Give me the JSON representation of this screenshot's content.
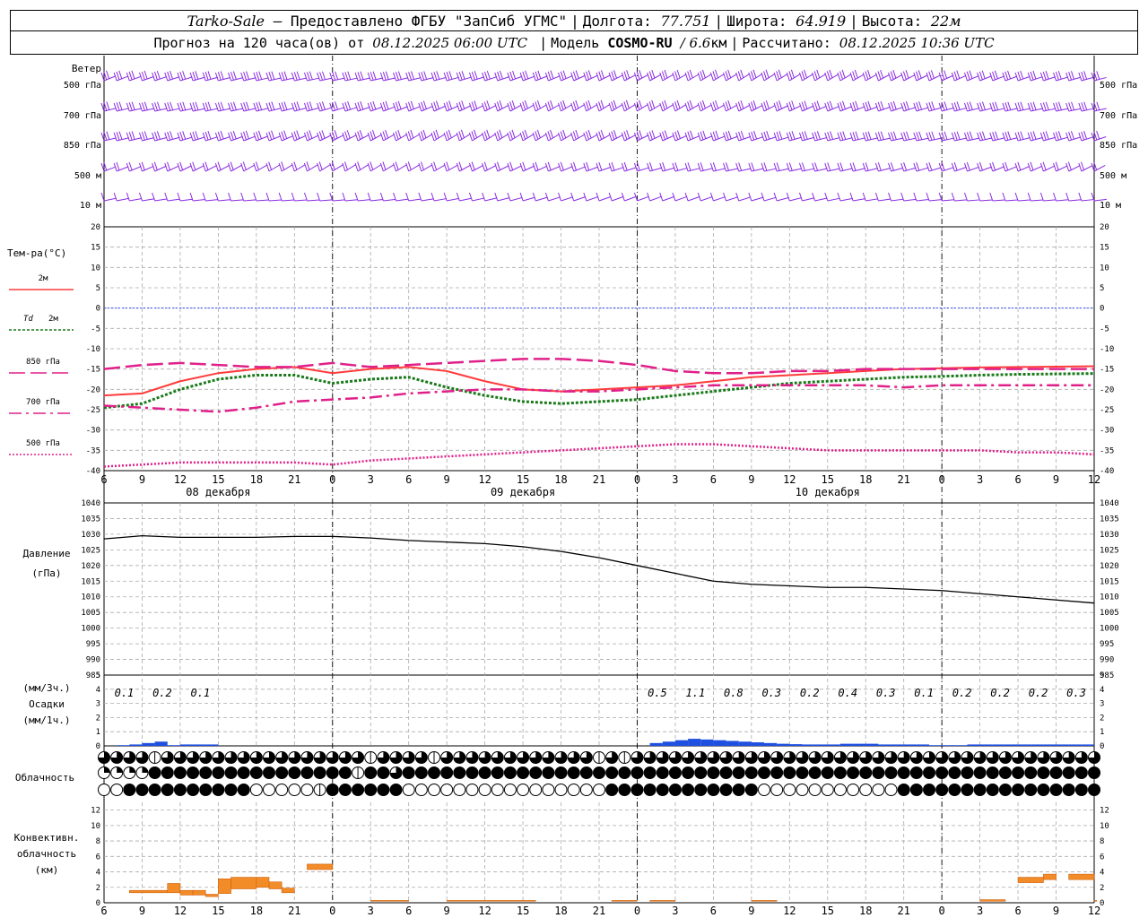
{
  "header": {
    "station": "Tarko-Sale",
    "provider": "– Предоставлено ФГБУ \"ЗапСиб УГМС\"",
    "lon_label": "Долгота:",
    "lon_value": "77.751",
    "lat_label": "Широта:",
    "lat_value": "64.919",
    "alt_label": "Высота:",
    "alt_value": "22м",
    "forecast_label": "Прогноз на 120 часа(ов) от",
    "forecast_start": "08.12.2025 06:00 UTC",
    "model_label": "Модель",
    "model_name": "COSMO-RU",
    "model_res": "/ 6.6",
    "model_res_unit": "км",
    "calc_label": "Рассчитано:",
    "calc_time": "08.12.2025 10:36 UTC"
  },
  "chart_data": [
    {
      "id": "wind",
      "type": "wind_barbs",
      "title": "Ветер",
      "levels": [
        "500 гПа",
        "700 гПа",
        "850 гПа",
        "500 м",
        "10 м"
      ],
      "barb_color": "#8a2be2"
    },
    {
      "id": "temperature",
      "type": "line",
      "ylabel": "Тем-ра(°C)",
      "ylim": [
        -40,
        20
      ],
      "yticks": [
        20,
        15,
        10,
        5,
        0,
        -5,
        -10,
        -15,
        -20,
        -25,
        -30,
        -35,
        -40
      ],
      "x_hours": [
        6,
        9,
        12,
        15,
        18,
        21,
        24,
        27,
        30,
        33,
        36,
        39,
        42,
        45,
        48,
        51,
        54,
        57,
        60,
        63,
        66,
        69,
        72,
        75,
        78,
        81,
        84
      ],
      "series": [
        {
          "name": "2м",
          "color": "#ff3b3b",
          "dash": "solid",
          "values": [
            -21.5,
            -21,
            -18,
            -16,
            -15,
            -14.5,
            -16,
            -15,
            -14.5,
            -15.5,
            -18,
            -20,
            -20.5,
            -20,
            -19.5,
            -19,
            -18,
            -17,
            -16.5,
            -16,
            -15.5,
            -15,
            -14.8,
            -14.6,
            -14.5,
            -14.4,
            -14.3
          ]
        },
        {
          "name": "Td 2м",
          "color": "#1a7a1a",
          "dash": "dot",
          "values": [
            -24.5,
            -23.5,
            -20,
            -17.5,
            -16.5,
            -16.5,
            -18.5,
            -17.5,
            -17,
            -19.5,
            -21.5,
            -23,
            -23.5,
            -23,
            -22.5,
            -21.5,
            -20.5,
            -19.5,
            -18.5,
            -18,
            -17.5,
            -17,
            -16.8,
            -16.5,
            -16.3,
            -16.2,
            -16.1
          ]
        },
        {
          "name": "850 гПа",
          "color": "#e0208a",
          "dash": "longdash",
          "values": [
            -15,
            -14,
            -13.5,
            -14,
            -14.5,
            -14.5,
            -13.5,
            -14.5,
            -14,
            -13.5,
            -13,
            -12.5,
            -12.5,
            -13,
            -14,
            -15.5,
            -16,
            -16,
            -15.5,
            -15.5,
            -15,
            -15,
            -15,
            -15,
            -15,
            -15,
            -15
          ]
        },
        {
          "name": "700 гПа",
          "color": "#e0208a",
          "dash": "dashdot",
          "values": [
            -24,
            -24.5,
            -25,
            -25.5,
            -24.5,
            -23,
            -22.5,
            -22,
            -21,
            -20.5,
            -20,
            -20,
            -20.5,
            -20.5,
            -20,
            -19.5,
            -19,
            -19,
            -19,
            -19,
            -19,
            -19.5,
            -19,
            -19,
            -19,
            -19,
            -19
          ]
        },
        {
          "name": "500 гПа",
          "color": "#e0208a",
          "dash": "smalldot",
          "values": [
            -39,
            -38.5,
            -38,
            -38,
            -38,
            -38,
            -38.5,
            -37.5,
            -37,
            -36.5,
            -36,
            -35.5,
            -35,
            -34.5,
            -34,
            -33.5,
            -33.5,
            -34,
            -34.5,
            -35,
            -35,
            -35,
            -35,
            -35,
            -35.5,
            -35.5,
            -36
          ]
        }
      ]
    },
    {
      "id": "pressure",
      "type": "line",
      "ylabel": "Давление",
      "yunit": "(гПа)",
      "ylim": [
        985,
        1040
      ],
      "yticks": [
        1040,
        1035,
        1030,
        1025,
        1020,
        1015,
        1010,
        1005,
        1000,
        995,
        990,
        985
      ],
      "x_hours": [
        6,
        9,
        12,
        15,
        18,
        21,
        24,
        27,
        30,
        33,
        36,
        39,
        42,
        45,
        48,
        51,
        54,
        57,
        60,
        63,
        66,
        69,
        72,
        75,
        78,
        81,
        84
      ],
      "series": [
        {
          "name": "Давление",
          "color": "#000000",
          "values": [
            1028.5,
            1029.5,
            1029,
            1029,
            1029,
            1029.3,
            1029.3,
            1028.8,
            1028,
            1027.5,
            1027,
            1026,
            1024.5,
            1022.5,
            1020,
            1017.5,
            1015,
            1014,
            1013.5,
            1013,
            1013,
            1012.5,
            1012,
            1011,
            1010,
            1009,
            1008
          ]
        }
      ]
    },
    {
      "id": "precipitation",
      "type": "bar",
      "ylabel": "Осадки",
      "yunit_top": "(мм/3ч.)",
      "yunit_bottom": "(мм/1ч.)",
      "ylim": [
        0,
        5
      ],
      "yticks": [
        5,
        4,
        3,
        2,
        1,
        0
      ],
      "totals_3h": [
        {
          "hour": 9,
          "value": "0.1"
        },
        {
          "hour": 12,
          "value": "0.2"
        },
        {
          "hour": 15,
          "value": "0.1"
        },
        {
          "hour": 51,
          "value": "0.5"
        },
        {
          "hour": 54,
          "value": "1.1"
        },
        {
          "hour": 57,
          "value": "0.8"
        },
        {
          "hour": 60,
          "value": "0.3"
        },
        {
          "hour": 63,
          "value": "0.2"
        },
        {
          "hour": 66,
          "value": "0.4"
        },
        {
          "hour": 69,
          "value": "0.3"
        },
        {
          "hour": 72,
          "value": "0.1"
        },
        {
          "hour": 75,
          "value": "0.2"
        },
        {
          "hour": 78,
          "value": "0.2"
        },
        {
          "hour": 81,
          "value": "0.2"
        },
        {
          "hour": 84,
          "value": "0.3"
        }
      ],
      "hourly": [
        {
          "hour": 8,
          "value": 0.05
        },
        {
          "hour": 9,
          "value": 0.1
        },
        {
          "hour": 10,
          "value": 0.2
        },
        {
          "hour": 11,
          "value": 0.3
        },
        {
          "hour": 12,
          "value": 0.05
        },
        {
          "hour": 13,
          "value": 0.1
        },
        {
          "hour": 14,
          "value": 0.1
        },
        {
          "hour": 15,
          "value": 0.1
        },
        {
          "hour": 50,
          "value": 0.2
        },
        {
          "hour": 51,
          "value": 0.3
        },
        {
          "hour": 52,
          "value": 0.4
        },
        {
          "hour": 53,
          "value": 0.5
        },
        {
          "hour": 54,
          "value": 0.45
        },
        {
          "hour": 55,
          "value": 0.4
        },
        {
          "hour": 56,
          "value": 0.35
        },
        {
          "hour": 57,
          "value": 0.3
        },
        {
          "hour": 58,
          "value": 0.25
        },
        {
          "hour": 59,
          "value": 0.2
        },
        {
          "hour": 60,
          "value": 0.15
        },
        {
          "hour": 61,
          "value": 0.12
        },
        {
          "hour": 62,
          "value": 0.1
        },
        {
          "hour": 63,
          "value": 0.1
        },
        {
          "hour": 64,
          "value": 0.1
        },
        {
          "hour": 65,
          "value": 0.15
        },
        {
          "hour": 66,
          "value": 0.15
        },
        {
          "hour": 67,
          "value": 0.15
        },
        {
          "hour": 68,
          "value": 0.1
        },
        {
          "hour": 69,
          "value": 0.1
        },
        {
          "hour": 70,
          "value": 0.1
        },
        {
          "hour": 71,
          "value": 0.1
        },
        {
          "hour": 72,
          "value": 0.05
        },
        {
          "hour": 73,
          "value": 0.05
        },
        {
          "hour": 74,
          "value": 0.05
        },
        {
          "hour": 75,
          "value": 0.1
        },
        {
          "hour": 76,
          "value": 0.1
        },
        {
          "hour": 77,
          "value": 0.1
        },
        {
          "hour": 78,
          "value": 0.1
        },
        {
          "hour": 79,
          "value": 0.1
        },
        {
          "hour": 80,
          "value": 0.1
        },
        {
          "hour": 81,
          "value": 0.1
        },
        {
          "hour": 82,
          "value": 0.1
        },
        {
          "hour": 83,
          "value": 0.1
        },
        {
          "hour": 84,
          "value": 0.1
        }
      ],
      "bar_color": "#1f4fe0"
    },
    {
      "id": "cloudiness",
      "type": "symbol_rows",
      "ylabel": "Облачность",
      "rows": [
        "qqqqhqqqqqqqqqqqqqqqqhqqqqhqqqqqqqqqqqqhqhqqqqqqqqqqqqqqqqqqqqqqqqqqqqqqqqqqqqqqqqqqqqqqqqqqqqqqqqqqq",
        "ttttffffffffffffffffhffqffffffffffffffffffffffffffffffffffffffffffffffffffffffffffffffffffffffffffffffffff",
        "eeffffffffffeeeeehffffffeeeeeeeeeeeeeeeeffffffffffffeeeeeeeeeeefffffffffffffffffffffffffffffffffffffffff"
      ]
    },
    {
      "id": "convective",
      "type": "bar",
      "ylabel_lines": [
        "Конвективн.",
        "облачность",
        "(км)"
      ],
      "ylim": [
        0,
        13
      ],
      "yticks": [
        12,
        10,
        8,
        6,
        4,
        2,
        0
      ],
      "segments": [
        {
          "h0": 8,
          "h1": 11,
          "bottom": 1.3,
          "top": 1.6
        },
        {
          "h0": 11,
          "h1": 12,
          "bottom": 1.3,
          "top": 2.5
        },
        {
          "h0": 12,
          "h1": 13,
          "bottom": 1.0,
          "top": 1.6
        },
        {
          "h0": 13,
          "h1": 14,
          "bottom": 1.0,
          "top": 1.6
        },
        {
          "h0": 14,
          "h1": 15,
          "bottom": 0.8,
          "top": 1.1
        },
        {
          "h0": 15,
          "h1": 16,
          "bottom": 1.2,
          "top": 3.1
        },
        {
          "h0": 16,
          "h1": 18,
          "bottom": 1.8,
          "top": 3.3
        },
        {
          "h0": 18,
          "h1": 19,
          "bottom": 2.0,
          "top": 3.3
        },
        {
          "h0": 19,
          "h1": 20,
          "bottom": 1.8,
          "top": 2.7
        },
        {
          "h0": 20,
          "h1": 21,
          "bottom": 1.3,
          "top": 1.9
        },
        {
          "h0": 22,
          "h1": 24,
          "bottom": 4.3,
          "top": 5.0
        },
        {
          "h0": 27,
          "h1": 30,
          "bottom": 0.2,
          "top": 0.3
        },
        {
          "h0": 33,
          "h1": 40,
          "bottom": 0.2,
          "top": 0.3
        },
        {
          "h0": 46,
          "h1": 48,
          "bottom": 0.2,
          "top": 0.3
        },
        {
          "h0": 49,
          "h1": 51,
          "bottom": 0.2,
          "top": 0.3
        },
        {
          "h0": 57,
          "h1": 59,
          "bottom": 0.2,
          "top": 0.3
        },
        {
          "h0": 75,
          "h1": 77,
          "bottom": 0.2,
          "top": 0.4
        },
        {
          "h0": 78,
          "h1": 80,
          "bottom": 2.6,
          "top": 3.3
        },
        {
          "h0": 80,
          "h1": 81,
          "bottom": 3.0,
          "top": 3.7
        },
        {
          "h0": 82,
          "h1": 84,
          "bottom": 3.0,
          "top": 3.7
        },
        {
          "h0": 84,
          "h1": 84.2,
          "bottom": 0.2,
          "top": 0.3
        }
      ],
      "bar_color": "#f28c28",
      "edge_color": "#d06010"
    }
  ],
  "time_axis": {
    "tick_labels": [
      "6",
      "9",
      "12",
      "15",
      "18",
      "21",
      "0",
      "3",
      "6",
      "9",
      "12",
      "15",
      "18",
      "21",
      "0",
      "3",
      "6",
      "9",
      "12",
      "15",
      "18",
      "21",
      "0",
      "3",
      "6",
      "9",
      "12"
    ],
    "days": [
      {
        "label": "08 декабря",
        "center_hour": 15
      },
      {
        "label": "09 декабря",
        "center_hour": 39
      },
      {
        "label": "10 декабря",
        "center_hour": 63
      }
    ]
  }
}
